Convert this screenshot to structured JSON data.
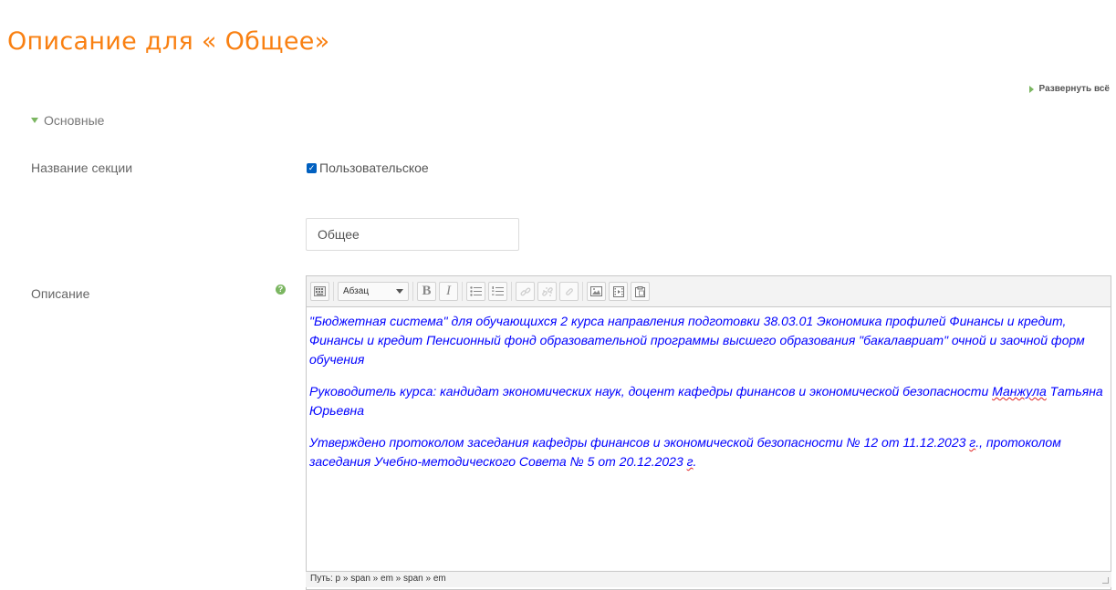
{
  "page": {
    "title": "Описание для « Общее»",
    "expand_all": "Развернуть всё"
  },
  "section": {
    "header": "Основные"
  },
  "form": {
    "section_name_label": "Название секции",
    "custom_checkbox_label": "Пользовательское",
    "custom_checked": true,
    "section_name_value": "Общее",
    "description_label": "Описание"
  },
  "editor": {
    "format_select": "Абзац",
    "paragraph1": "\"Бюджетная система\" для обучающихся 2 курса направления подготовки 38.03.01 Экономика профилей Финансы и кредит, Финансы и кредит Пенсионный фонд образовательной программы высшего образования \"бакалавриат\" очной и заочной форм обучения",
    "paragraph2_a": "Руководитель курса: кандидат экономических наук, доцент кафедры финансов и экономической безопасности ",
    "paragraph2_surname": "Манжула",
    "paragraph2_b": " Татьяна Юрьевна",
    "paragraph3_a": "Утверждено протоколом заседания кафедры финансов и экономической безопасности № 12 от 11.12.2023 ",
    "paragraph3_g1": "г",
    "paragraph3_b": "., протоколом заседания Учебно-методического Совета № 5 от 20.12.2023 ",
    "paragraph3_g2": "г",
    "paragraph3_c": ".",
    "status_path": "Путь: p » span » em » span » em"
  },
  "colors": {
    "title": "#f98012",
    "accent_green": "#7bb661",
    "editor_text": "#0000ff",
    "checkbox": "#0060c0"
  },
  "icons": {
    "toolbar": [
      "keyboard-toggle-icon",
      "bold-icon",
      "italic-icon",
      "unordered-list-icon",
      "ordered-list-icon",
      "link-icon",
      "unlink-icon",
      "anchor-icon",
      "image-icon",
      "media-icon",
      "paste-icon"
    ]
  }
}
